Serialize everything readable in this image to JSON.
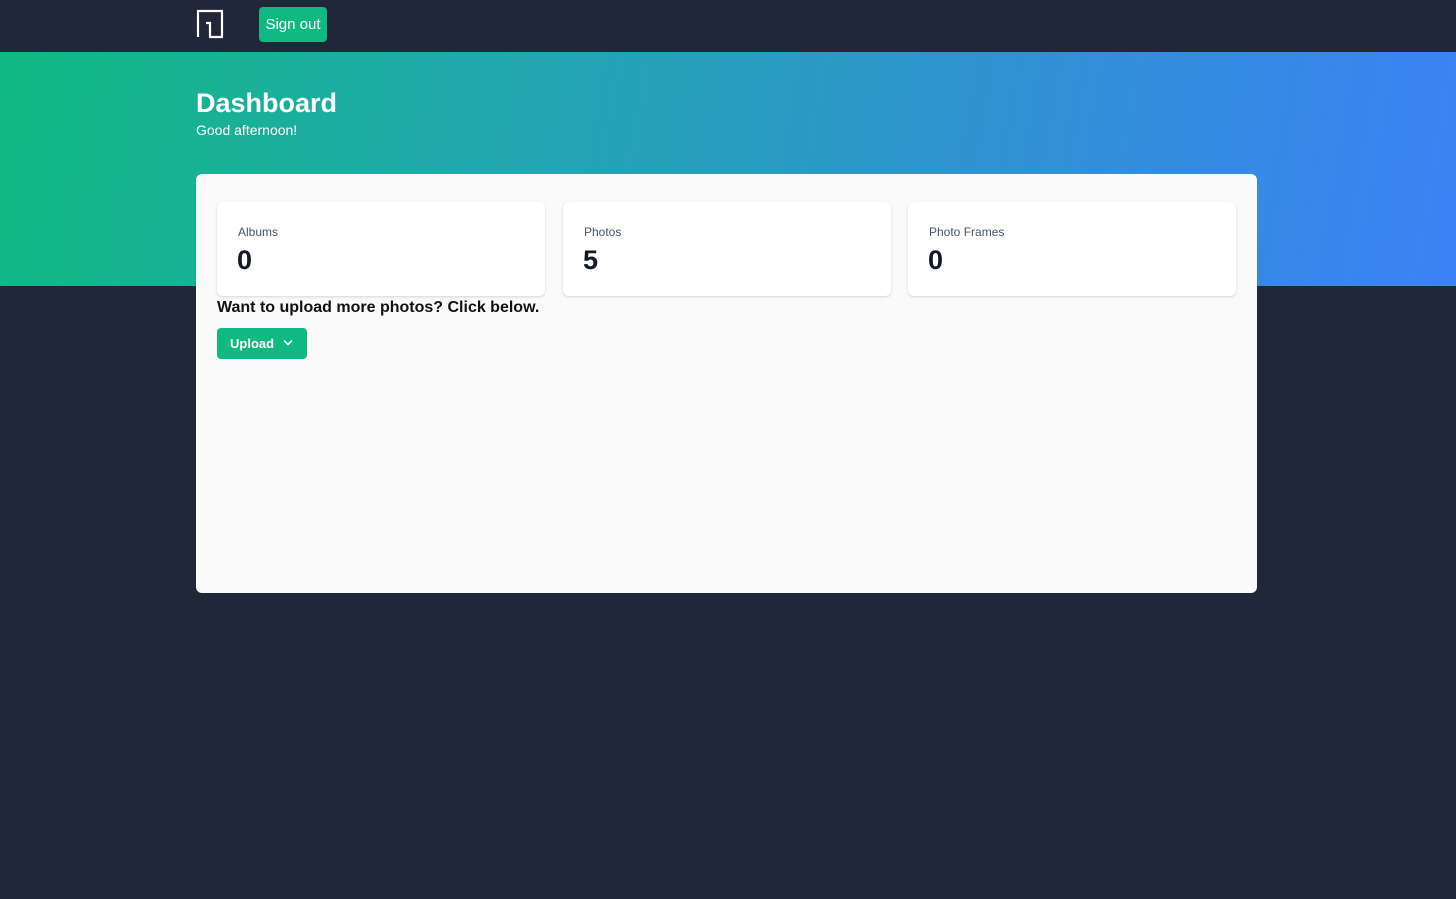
{
  "topbar": {
    "logo_icon": "app-logo-icon",
    "signout_label": "Sign out"
  },
  "hero": {
    "title": "Dashboard",
    "subtitle": "Good afternoon!"
  },
  "stats": [
    {
      "label": "Albums",
      "value": "0"
    },
    {
      "label": "Photos",
      "value": "5"
    },
    {
      "label": "Photo Frames",
      "value": "0"
    }
  ],
  "upload": {
    "heading": "Want to upload more photos? Click below.",
    "button_label": "Upload",
    "button_icon": "chevron-down-icon"
  },
  "colors": {
    "background": "#1f2739",
    "accent": "#10b981",
    "gradient_start": "#10b981",
    "gradient_end": "#3b82f6",
    "panel": "#fafafa"
  }
}
